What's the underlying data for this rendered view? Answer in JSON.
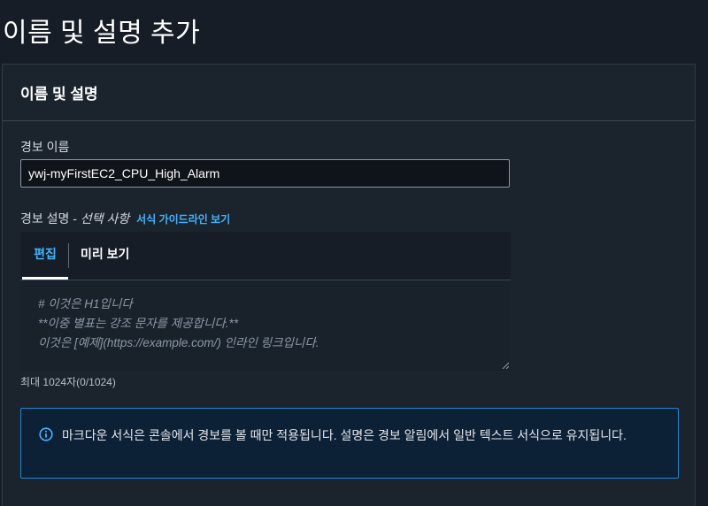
{
  "page": {
    "title": "이름 및 설명 추가"
  },
  "panel": {
    "title": "이름 및 설명"
  },
  "alarm_name": {
    "label": "경보 이름",
    "value": "ywj-myFirstEC2_CPU_High_Alarm"
  },
  "description": {
    "label": "경보 설명 - ",
    "optional_label": "선택 사항",
    "guide_link": "서식 가이드라인 보기",
    "tabs": {
      "edit": "편집",
      "preview": "미리 보기"
    },
    "placeholder_lines": [
      "# 이것은 H1입니다",
      "**이중 별표는 강조 문자를 제공합니다.**",
      "이것은 [예제](https://example.com/) 인라인 링크입니다."
    ],
    "char_count": "최대 1024자(0/1024)"
  },
  "info": {
    "icon": "info-icon",
    "text": "마크다운 서식은 콘솔에서 경보를 볼 때만 적용됩니다. 설명은 경보 알림에서 일반 텍스트 서식으로 유지됩니다."
  },
  "colors": {
    "background": "#161d26",
    "panel": "#1b232d",
    "accent": "#42b4ff",
    "info_border": "#1e8ad6",
    "info_background": "#0c2036"
  }
}
